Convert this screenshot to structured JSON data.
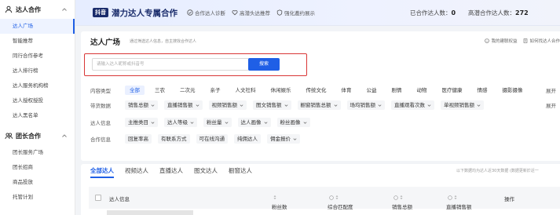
{
  "sidebar": {
    "group1": {
      "label": "达人合作"
    },
    "items1": [
      {
        "label": "达人广场"
      },
      {
        "label": "智能推荐"
      },
      {
        "label": "同行合作参考"
      },
      {
        "label": "达人排行榜"
      },
      {
        "label": "达人服务机构榜"
      },
      {
        "label": "达人授权授投"
      },
      {
        "label": "达人黑名单"
      }
    ],
    "group2": {
      "label": "团长合作"
    },
    "items2": [
      {
        "label": "团长服务广场"
      },
      {
        "label": "团长招商"
      },
      {
        "label": "商品投放"
      },
      {
        "label": "托管计划"
      }
    ]
  },
  "header": {
    "badge": "抖音",
    "title": "潜力达人专属合作",
    "features": [
      "合作达人诊断",
      "高潜头达推荐",
      "强化邀约展示"
    ],
    "stat1_label": "已合作达人数：",
    "stat1_value": "0",
    "stat2_label": "高潜合作达人数：",
    "stat2_value": "272"
  },
  "main": {
    "title": "达人广场",
    "subtitle": "通过筛选达人信息，自主搜找合作达人",
    "link1": "我的建联权益",
    "link2": "如何找达人合作",
    "search_placeholder": "请输入达人昵称或抖音号",
    "search_button": "搜索",
    "filters": {
      "content_label": "内容类型",
      "content_chips": [
        "全部",
        "三农",
        "二次元",
        "亲子",
        "人文社科",
        "休闲娱乐",
        "传统文化",
        "体育",
        "公益",
        "剧情",
        "动物",
        "医疗健康",
        "情感",
        "摄影摄像"
      ],
      "expand": "展开",
      "goods_label": "带货数据",
      "goods_chips": [
        "销售总额",
        "直播销售额",
        "视频销售额",
        "图文销售额",
        "橱窗销售总额",
        "场均销售额",
        "直播观看次数",
        "单视频销售额"
      ],
      "info_label": "达人信息",
      "info_chips": [
        "主推类目",
        "达人等级",
        "粉丝量",
        "达人画像",
        "粉丝画像"
      ],
      "coop_label": "合作信息",
      "coop_chips": [
        "回复率高",
        "有联系方式",
        "可在线沟通",
        "纯佣达人",
        "佣金报价"
      ]
    }
  },
  "list": {
    "tabs": [
      "全部达人",
      "视频达人",
      "直播达人",
      "图文达人",
      "橱窗达人"
    ],
    "note": "以下数据均为达人近30天数据 (数据更新於近一",
    "columns": {
      "info": "达人信息",
      "fans": "粉丝数",
      "match": "综合匹配度",
      "sales": "销售总额",
      "live_sales": "直播销售额",
      "ops": "操作"
    }
  },
  "colors": {
    "accent": "#1f5fe6",
    "highlight": "#d93636"
  }
}
